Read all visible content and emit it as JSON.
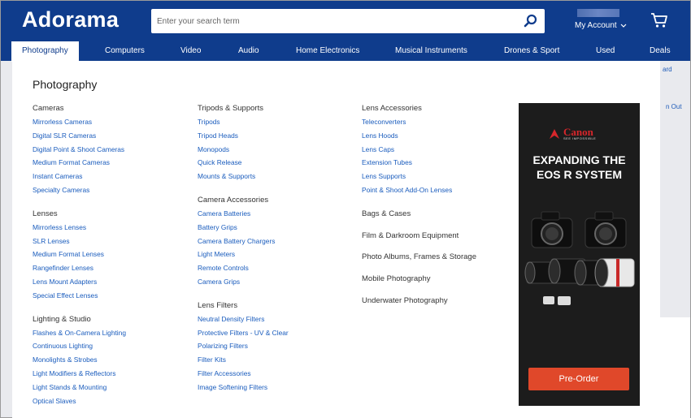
{
  "brand": {
    "logo": "Adorama"
  },
  "search": {
    "placeholder": "Enter your search term"
  },
  "account": {
    "label": "My Account"
  },
  "nav": [
    "Photography",
    "Computers",
    "Video",
    "Audio",
    "Home Electronics",
    "Musical Instruments",
    "Drones & Sport",
    "Used",
    "Deals"
  ],
  "background": {
    "text1": "ard",
    "text2": "n Out"
  },
  "menu": {
    "title": "Photography",
    "col1": [
      {
        "title": "Cameras",
        "links": [
          "Mirrorless Cameras",
          "Digital SLR Cameras",
          "Digital Point & Shoot Cameras",
          "Medium Format Cameras",
          "Instant Cameras",
          "Specialty Cameras"
        ]
      },
      {
        "title": "Lenses",
        "links": [
          "Mirrorless Lenses",
          "SLR Lenses",
          "Medium Format Lenses",
          "Rangefinder Lenses",
          "Lens Mount Adapters",
          "Special Effect Lenses"
        ]
      },
      {
        "title": "Lighting & Studio",
        "links": [
          "Flashes & On-Camera Lighting",
          "Continuous Lighting",
          "Monolights & Strobes",
          "Light Modifiers & Reflectors",
          "Light Stands & Mounting",
          "Optical Slaves"
        ]
      }
    ],
    "col2": [
      {
        "title": "Tripods & Supports",
        "links": [
          "Tripods",
          "Tripod Heads",
          "Monopods",
          "Quick Release",
          "Mounts & Supports"
        ]
      },
      {
        "title": "Camera Accessories",
        "links": [
          "Camera Batteries",
          "Battery Grips",
          "Camera Battery Chargers",
          "Light Meters",
          "Remote Controls",
          "Camera Grips"
        ]
      },
      {
        "title": "Lens Filters",
        "links": [
          "Neutral Density Filters",
          "Protective Filters - UV & Clear",
          "Polarizing Filters",
          "Filter Kits",
          "Filter Accessories",
          "Image Softening Filters"
        ]
      }
    ],
    "col3": {
      "group": {
        "title": "Lens Accessories",
        "links": [
          "Teleconverters",
          "Lens Hoods",
          "Lens Caps",
          "Extension Tubes",
          "Lens Supports",
          "Point & Shoot Add-On Lenses"
        ]
      },
      "items": [
        "Bags & Cases",
        "Film & Darkroom Equipment",
        "Photo Albums, Frames & Storage",
        "Mobile Photography",
        "Underwater Photography"
      ]
    }
  },
  "ad": {
    "brand": "Canon",
    "tagline": "SEE IMPOSSIBLE",
    "headline1": "EXPANDING THE",
    "headline2": "EOS R SYSTEM",
    "cta": "Pre-Order"
  }
}
